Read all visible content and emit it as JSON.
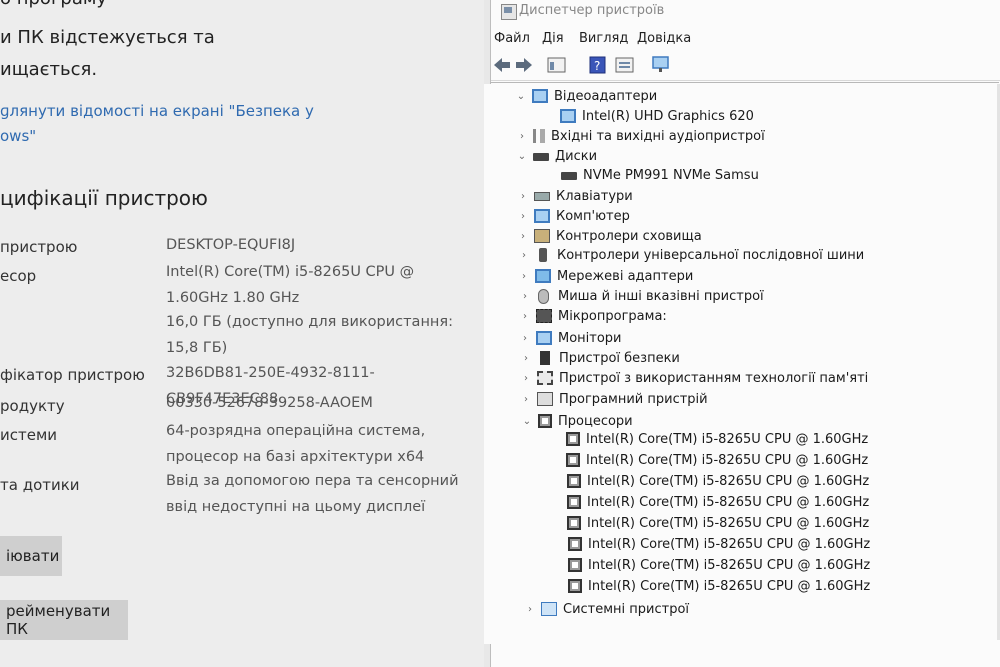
{
  "settings": {
    "header_line1": "о програму",
    "header_line2": "и ПК відстежується та",
    "header_line3": "ищається.",
    "link_line1": "ɡлянути відомості на екрані \"Безпека у",
    "link_line2": "ows\"",
    "section_title": "цифікації пристрою",
    "specs": [
      {
        "label": "пристрою",
        "value": "DESKTOP-EQUFI8J"
      },
      {
        "label": "есор",
        "value": "Intel(R) Core(TM) i5-8265U CPU @ 1.60GHz   1.80 GHz"
      },
      {
        "label": "",
        "value": "16,0 ГБ (доступно для використання: 15,8 ГБ)"
      },
      {
        "label": "фікатор пристрою",
        "value": "32B6DB81-250E-4932-8111-CB9F47E3EC88"
      },
      {
        "label": "родукту",
        "value": "00330-52678-39258-AAOEM"
      },
      {
        "label": "истеми",
        "value": "64-розрядна операційна система, процесор на базі архітектури x64"
      },
      {
        "label": "та дотики",
        "value": "Ввід за допомогою пера та сенсорний ввід недоступні на цьому дисплеї"
      }
    ],
    "copy_button": "іювати",
    "rename_button": "реймeнувати ПК"
  },
  "devmgr": {
    "title": "Диспетчер пристроїв",
    "menu": [
      "Файл",
      "Дія",
      "Вигляд",
      "Довідка"
    ],
    "tree": [
      {
        "label": "Відеоадаптери",
        "level": 0,
        "expanded": true,
        "icon": "monitor-icon"
      },
      {
        "label": "Intel(R) UHD Graphics 620",
        "level": 1,
        "icon": "monitor-icon"
      },
      {
        "label": "Вхідні та вихідні аудіопристрої",
        "level": 0,
        "expanded": false,
        "icon": "speaker-icon"
      },
      {
        "label": "Диски",
        "level": 0,
        "expanded": true,
        "icon": "disk-icon"
      },
      {
        "label": "NVMe PM991 NVMe Samsu",
        "level": 1,
        "icon": "disk-icon"
      },
      {
        "label": "Клавіатури",
        "level": 0,
        "expanded": false,
        "icon": "keyboard-icon"
      },
      {
        "label": "Комп'ютер",
        "level": 0,
        "expanded": false,
        "icon": "monitor-icon"
      },
      {
        "label": "Контролери сховища",
        "level": 0,
        "expanded": false,
        "icon": "storage-icon"
      },
      {
        "label": "Контролери універсальної послідовної шини",
        "level": 0,
        "expanded": false,
        "icon": "usb-icon"
      },
      {
        "label": "Мережеві адаптери",
        "level": 0,
        "expanded": false,
        "icon": "network-icon"
      },
      {
        "label": "Миша й інші вказівні пристрої",
        "level": 0,
        "expanded": false,
        "icon": "mouse-icon"
      },
      {
        "label": "Мікропрограма:",
        "level": 0,
        "expanded": false,
        "icon": "chip-icon"
      },
      {
        "label": "Монітори",
        "level": 0,
        "expanded": false,
        "icon": "monitor-icon"
      },
      {
        "label": "Пристрої безпеки",
        "level": 0,
        "expanded": false,
        "icon": "security-icon"
      },
      {
        "label": "Пристрої з використанням технології пам'яті",
        "level": 0,
        "expanded": false,
        "icon": "memory-icon"
      },
      {
        "label": "Програмний пристрій",
        "level": 0,
        "expanded": false,
        "icon": "program-icon"
      },
      {
        "label": "Процесори",
        "level": 0,
        "expanded": true,
        "icon": "cpu-icon"
      },
      {
        "label": "Intel(R) Core(TM) i5-8265U CPU @ 1.60GHz",
        "level": 1,
        "icon": "cpu-icon"
      },
      {
        "label": "Intel(R) Core(TM) i5-8265U CPU @ 1.60GHz",
        "level": 1,
        "icon": "cpu-icon"
      },
      {
        "label": "Intel(R) Core(TM) i5-8265U CPU @ 1.60GHz",
        "level": 1,
        "icon": "cpu-icon"
      },
      {
        "label": "Intel(R) Core(TM) i5-8265U CPU @ 1.60GHz",
        "level": 1,
        "icon": "cpu-icon"
      },
      {
        "label": "Intel(R) Core(TM) i5-8265U CPU @ 1.60GHz",
        "level": 1,
        "icon": "cpu-icon"
      },
      {
        "label": "Intel(R) Core(TM) i5-8265U CPU @ 1.60GHz",
        "level": 1,
        "icon": "cpu-icon"
      },
      {
        "label": "Intel(R) Core(TM) i5-8265U CPU @ 1.60GHz",
        "level": 1,
        "icon": "cpu-icon"
      },
      {
        "label": "Intel(R) Core(TM) i5-8265U CPU @ 1.60GHz",
        "level": 1,
        "icon": "cpu-icon"
      },
      {
        "label": "Системні пристрої",
        "level": 0,
        "expanded": false,
        "icon": "system-icon"
      }
    ]
  }
}
